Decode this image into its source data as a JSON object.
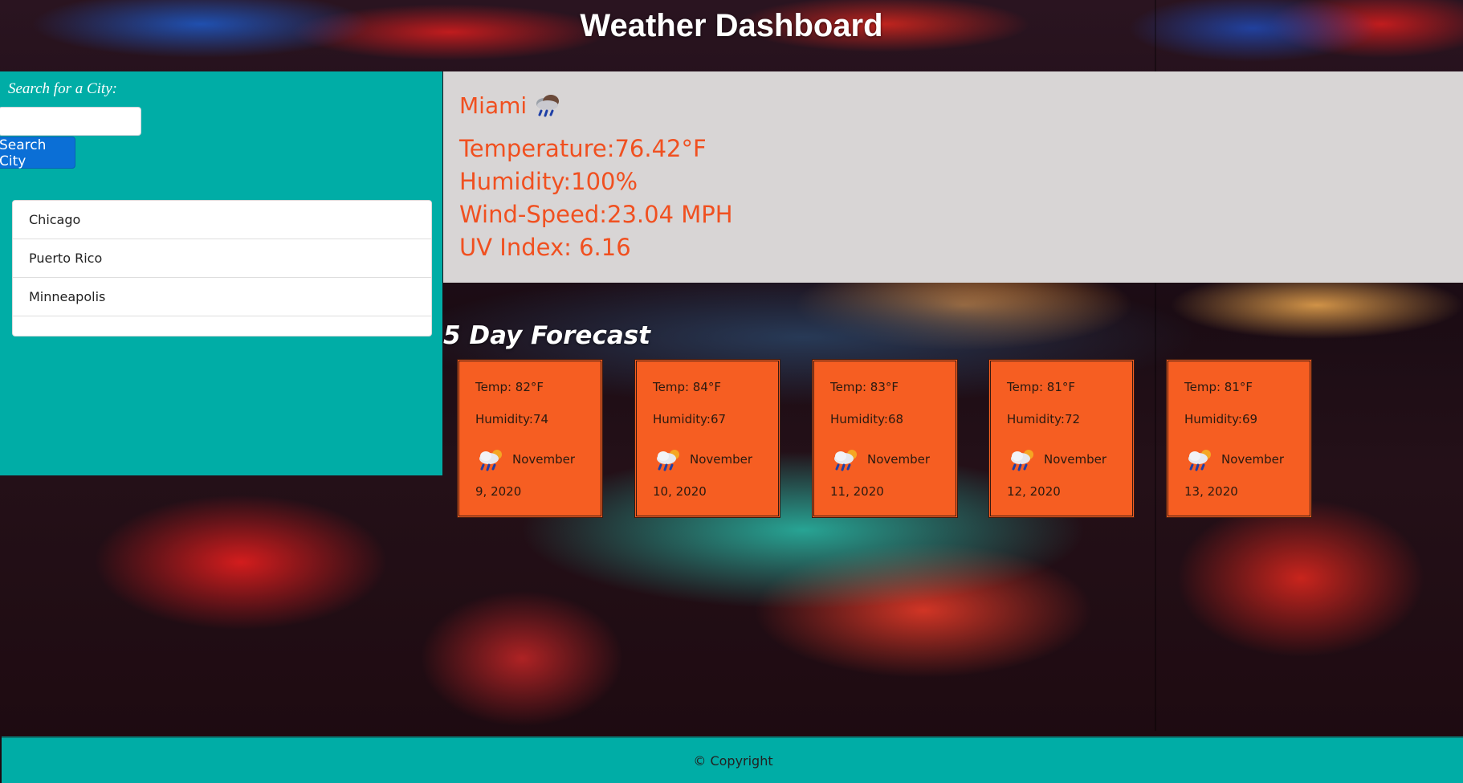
{
  "header": {
    "title": "Weather Dashboard"
  },
  "search": {
    "label": "Search for a City:",
    "input_value": "",
    "placeholder": "",
    "button_label": "Search City"
  },
  "history": {
    "items": [
      "Chicago",
      "Puerto Rico",
      "Minneapolis"
    ]
  },
  "current": {
    "city": "Miami",
    "icon": "rain-cloud-icon",
    "temperature": "Temperature:76.42°F",
    "humidity": "Humidity:100%",
    "wind": "Wind-Speed:23.04 MPH",
    "uv": "UV Index: 6.16"
  },
  "forecast": {
    "title": "5 Day Forecast",
    "days": [
      {
        "temp": "Temp: 82°F",
        "humidity": "Humidity:74",
        "month": "November",
        "date_rest": "9, 2020",
        "icon": "sun-rain-cloud-icon"
      },
      {
        "temp": "Temp: 84°F",
        "humidity": "Humidity:67",
        "month": "November",
        "date_rest": "10, 2020",
        "icon": "sun-rain-cloud-icon"
      },
      {
        "temp": "Temp: 83°F",
        "humidity": "Humidity:68",
        "month": "November",
        "date_rest": "11, 2020",
        "icon": "sun-rain-cloud-icon"
      },
      {
        "temp": "Temp: 81°F",
        "humidity": "Humidity:72",
        "month": "November",
        "date_rest": "12, 2020",
        "icon": "sun-rain-cloud-icon"
      },
      {
        "temp": "Temp: 81°F",
        "humidity": "Humidity:69",
        "month": "November",
        "date_rest": "13, 2020",
        "icon": "sun-rain-cloud-icon"
      }
    ]
  },
  "footer": {
    "text": "© Copyright"
  },
  "colors": {
    "teal": "#00ada6",
    "card_orange": "#f65e22",
    "current_text": "#f05020",
    "current_bg": "#d8d5d5",
    "button_blue": "#0b6fd6"
  }
}
